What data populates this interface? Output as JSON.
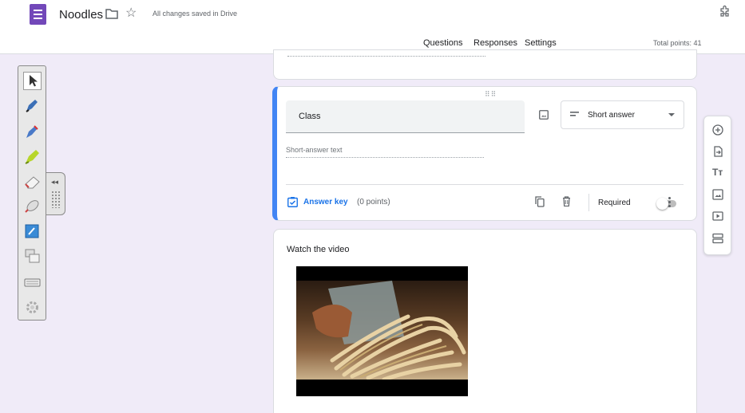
{
  "header": {
    "title": "Noodles",
    "saved_status": "All changes saved in Drive",
    "tabs": [
      {
        "label": "Questions",
        "active": true
      },
      {
        "label": "Responses",
        "active": false
      },
      {
        "label": "Settings",
        "active": false
      }
    ],
    "total_points": "Total points: 41"
  },
  "question": {
    "title": "Class",
    "type": "Short answer",
    "placeholder": "Short-answer text",
    "answer_key": "Answer key",
    "points": "(0 points)",
    "required_label": "Required",
    "required": false
  },
  "video_item": {
    "title": "Watch the video"
  },
  "floating_toolbar": [
    "add-question-icon",
    "import-questions-icon",
    "add-title-icon",
    "add-image-icon",
    "add-video-icon",
    "add-section-icon"
  ],
  "smart_tools": [
    "select-icon",
    "pen-icon",
    "creative-pen-icon",
    "highlighter-icon",
    "eraser-icon",
    "magic-pen-icon",
    "screen-capture-icon",
    "screen-shade-icon",
    "keyboard-icon",
    "settings-icon"
  ],
  "colors": {
    "accent": "#673ab7",
    "question_border": "#4285f4",
    "link": "#1a73e8",
    "background": "#f0ebf8"
  }
}
